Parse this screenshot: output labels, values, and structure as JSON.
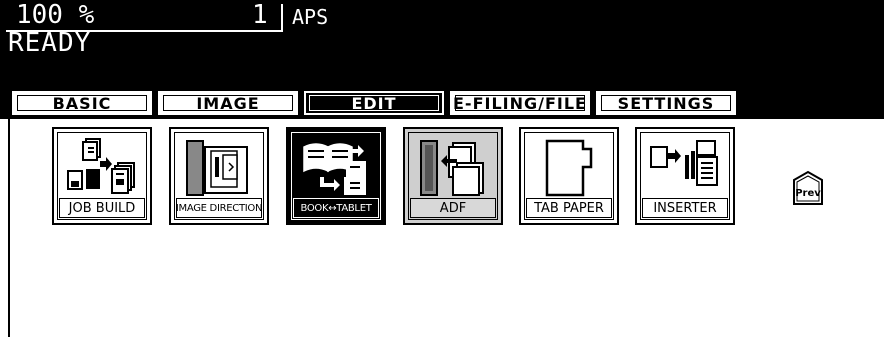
{
  "status": {
    "zoom": "100 %",
    "quantity": "1",
    "paper": "APS",
    "message": "READY"
  },
  "tabs": [
    {
      "label": "BASIC",
      "active": false
    },
    {
      "label": "IMAGE",
      "active": false
    },
    {
      "label": "EDIT",
      "active": true
    },
    {
      "label": "E-FILING/FILE",
      "active": false
    },
    {
      "label": "SETTINGS",
      "active": false
    }
  ],
  "functions": [
    {
      "label": "JOB BUILD",
      "icon": "job-build-icon",
      "state": "normal"
    },
    {
      "label": "IMAGE DIRECTION",
      "icon": "image-direction-icon",
      "state": "normal"
    },
    {
      "label": "BOOK↔TABLET",
      "icon": "book-tablet-icon",
      "state": "active"
    },
    {
      "label": "ADF",
      "icon": "adf-icon",
      "state": "disabled"
    },
    {
      "label": "TAB PAPER",
      "icon": "tab-paper-icon",
      "state": "normal"
    },
    {
      "label": "INSERTER",
      "icon": "inserter-icon",
      "state": "normal"
    }
  ],
  "prev_label": "Prev"
}
